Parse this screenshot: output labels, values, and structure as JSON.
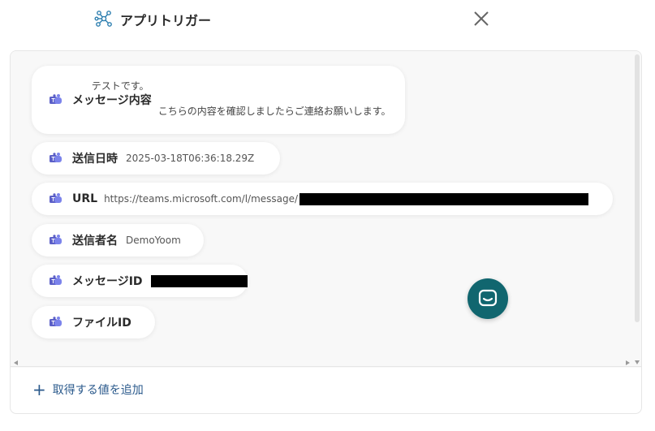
{
  "header": {
    "title": "アプリトリガー",
    "logo_icon": "network-nodes-icon",
    "close_icon": "close-icon"
  },
  "fields": {
    "message": {
      "label": "メッセージ内容",
      "lines": [
        "テストです。",
        "こちらの内容を確認しましたらご連絡お願いします。"
      ]
    },
    "sent_at": {
      "label": "送信日時",
      "value": "2025-03-18T06:36:18.29Z"
    },
    "url": {
      "label": "URL",
      "value": "https://teams.microsoft.com/l/message/"
    },
    "sender": {
      "label": "送信者名",
      "value": "DemoYoom"
    },
    "message_id": {
      "label": "メッセージID"
    },
    "file_id": {
      "label": "ファイルID"
    }
  },
  "footer": {
    "add_label": "取得する値を追加",
    "add_icon": "plus-icon"
  },
  "chat": {
    "icon": "chat-bubble-icon"
  },
  "colors": {
    "accent": "#2b5a8c",
    "chat_fab": "#11666f",
    "teams_purple": "#5b5fc7"
  }
}
